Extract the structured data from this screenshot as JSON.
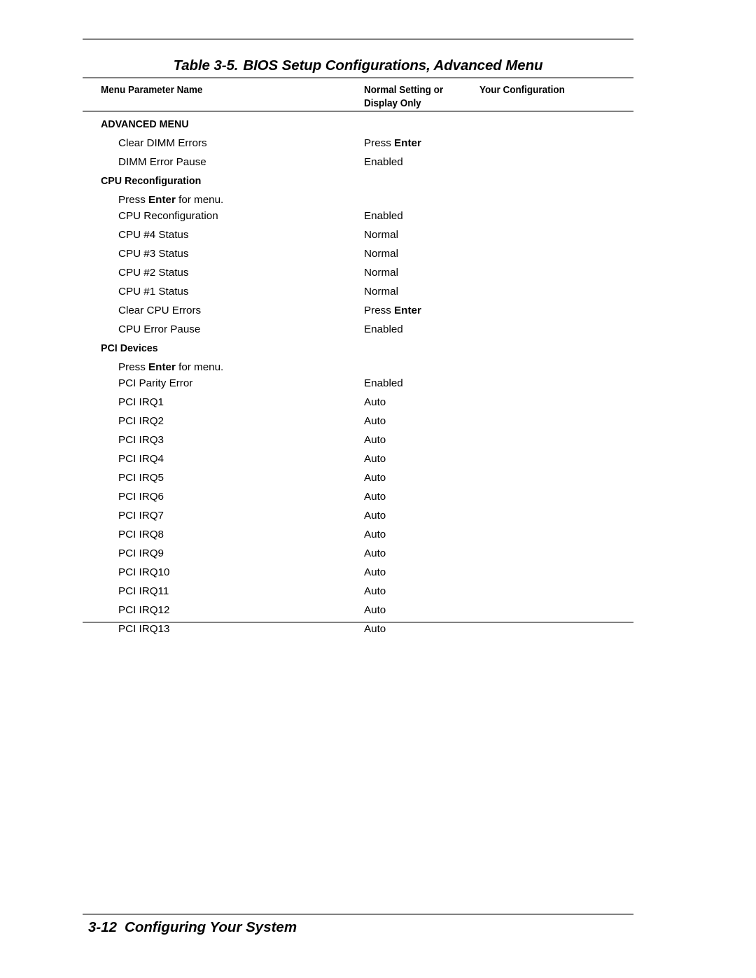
{
  "document": {
    "table_caption_prefix": "Table 3-5.",
    "table_caption_text": "BIOS Setup Configurations, Advanced Menu",
    "footer_page_number": "3-12",
    "footer_section_title": "Configuring Your System",
    "rule_color": "#808080"
  },
  "table": {
    "columns": [
      "Menu Parameter Name",
      "Normal Setting or Display Only",
      "Your Configuration"
    ],
    "column_headers": {
      "parameter": "Menu Parameter Name",
      "normal_line1": "Normal Setting or",
      "normal_line2": "Display Only",
      "your_configuration": "Your Configuration"
    },
    "rows": [
      {
        "kind": "section",
        "flush": true,
        "label": "ADVANCED MENU"
      },
      {
        "kind": "item",
        "name": "Clear DIMM Errors",
        "value_pre": "Press ",
        "value_bold": "Enter",
        "value_post": "",
        "config": ""
      },
      {
        "kind": "item",
        "name": "DIMM Error Pause",
        "value_pre": "Enabled",
        "value_bold": "",
        "value_post": "",
        "config": ""
      },
      {
        "kind": "section",
        "flush": true,
        "label": "CPU Reconfiguration"
      },
      {
        "kind": "subnote",
        "pre": "Press ",
        "bold": "Enter",
        "post": " for menu."
      },
      {
        "kind": "item",
        "name": "CPU Reconfiguration",
        "value_pre": "Enabled",
        "value_bold": "",
        "value_post": "",
        "config": ""
      },
      {
        "kind": "item",
        "name": "CPU #4 Status",
        "value_pre": "Normal",
        "value_bold": "",
        "value_post": "",
        "config": ""
      },
      {
        "kind": "item",
        "name": "CPU #3 Status",
        "value_pre": "Normal",
        "value_bold": "",
        "value_post": "",
        "config": ""
      },
      {
        "kind": "item",
        "name": "CPU #2 Status",
        "value_pre": "Normal",
        "value_bold": "",
        "value_post": "",
        "config": ""
      },
      {
        "kind": "item",
        "name": "CPU #1 Status",
        "value_pre": "Normal",
        "value_bold": "",
        "value_post": "",
        "config": ""
      },
      {
        "kind": "item",
        "name": "Clear CPU Errors",
        "value_pre": "Press ",
        "value_bold": "Enter",
        "value_post": "",
        "config": ""
      },
      {
        "kind": "item",
        "name": "CPU Error Pause",
        "value_pre": "Enabled",
        "value_bold": "",
        "value_post": "",
        "config": ""
      },
      {
        "kind": "section",
        "flush": true,
        "label": "PCI Devices"
      },
      {
        "kind": "subnote",
        "pre": "Press ",
        "bold": "Enter",
        "post": " for menu."
      },
      {
        "kind": "item",
        "name": "PCI Parity Error",
        "value_pre": "Enabled",
        "value_bold": "",
        "value_post": "",
        "config": ""
      },
      {
        "kind": "item",
        "name": "PCI IRQ1",
        "value_pre": "Auto",
        "value_bold": "",
        "value_post": "",
        "config": ""
      },
      {
        "kind": "item",
        "name": "PCI IRQ2",
        "value_pre": "Auto",
        "value_bold": "",
        "value_post": "",
        "config": ""
      },
      {
        "kind": "item",
        "name": "PCI IRQ3",
        "value_pre": "Auto",
        "value_bold": "",
        "value_post": "",
        "config": ""
      },
      {
        "kind": "item",
        "name": "PCI IRQ4",
        "value_pre": "Auto",
        "value_bold": "",
        "value_post": "",
        "config": ""
      },
      {
        "kind": "item",
        "name": "PCI IRQ5",
        "value_pre": "Auto",
        "value_bold": "",
        "value_post": "",
        "config": ""
      },
      {
        "kind": "item",
        "name": "PCI IRQ6",
        "value_pre": "Auto",
        "value_bold": "",
        "value_post": "",
        "config": ""
      },
      {
        "kind": "item",
        "name": "PCI IRQ7",
        "value_pre": "Auto",
        "value_bold": "",
        "value_post": "",
        "config": ""
      },
      {
        "kind": "item",
        "name": "PCI IRQ8",
        "value_pre": "Auto",
        "value_bold": "",
        "value_post": "",
        "config": ""
      },
      {
        "kind": "item",
        "name": "PCI IRQ9",
        "value_pre": "Auto",
        "value_bold": "",
        "value_post": "",
        "config": ""
      },
      {
        "kind": "item",
        "name": "PCI IRQ10",
        "value_pre": "Auto",
        "value_bold": "",
        "value_post": "",
        "config": ""
      },
      {
        "kind": "item",
        "name": "PCI IRQ11",
        "value_pre": "Auto",
        "value_bold": "",
        "value_post": "",
        "config": ""
      },
      {
        "kind": "item",
        "name": "PCI IRQ12",
        "value_pre": "Auto",
        "value_bold": "",
        "value_post": "",
        "config": ""
      },
      {
        "kind": "item",
        "name": "PCI IRQ13",
        "value_pre": "Auto",
        "value_bold": "",
        "value_post": "",
        "config": ""
      }
    ]
  }
}
